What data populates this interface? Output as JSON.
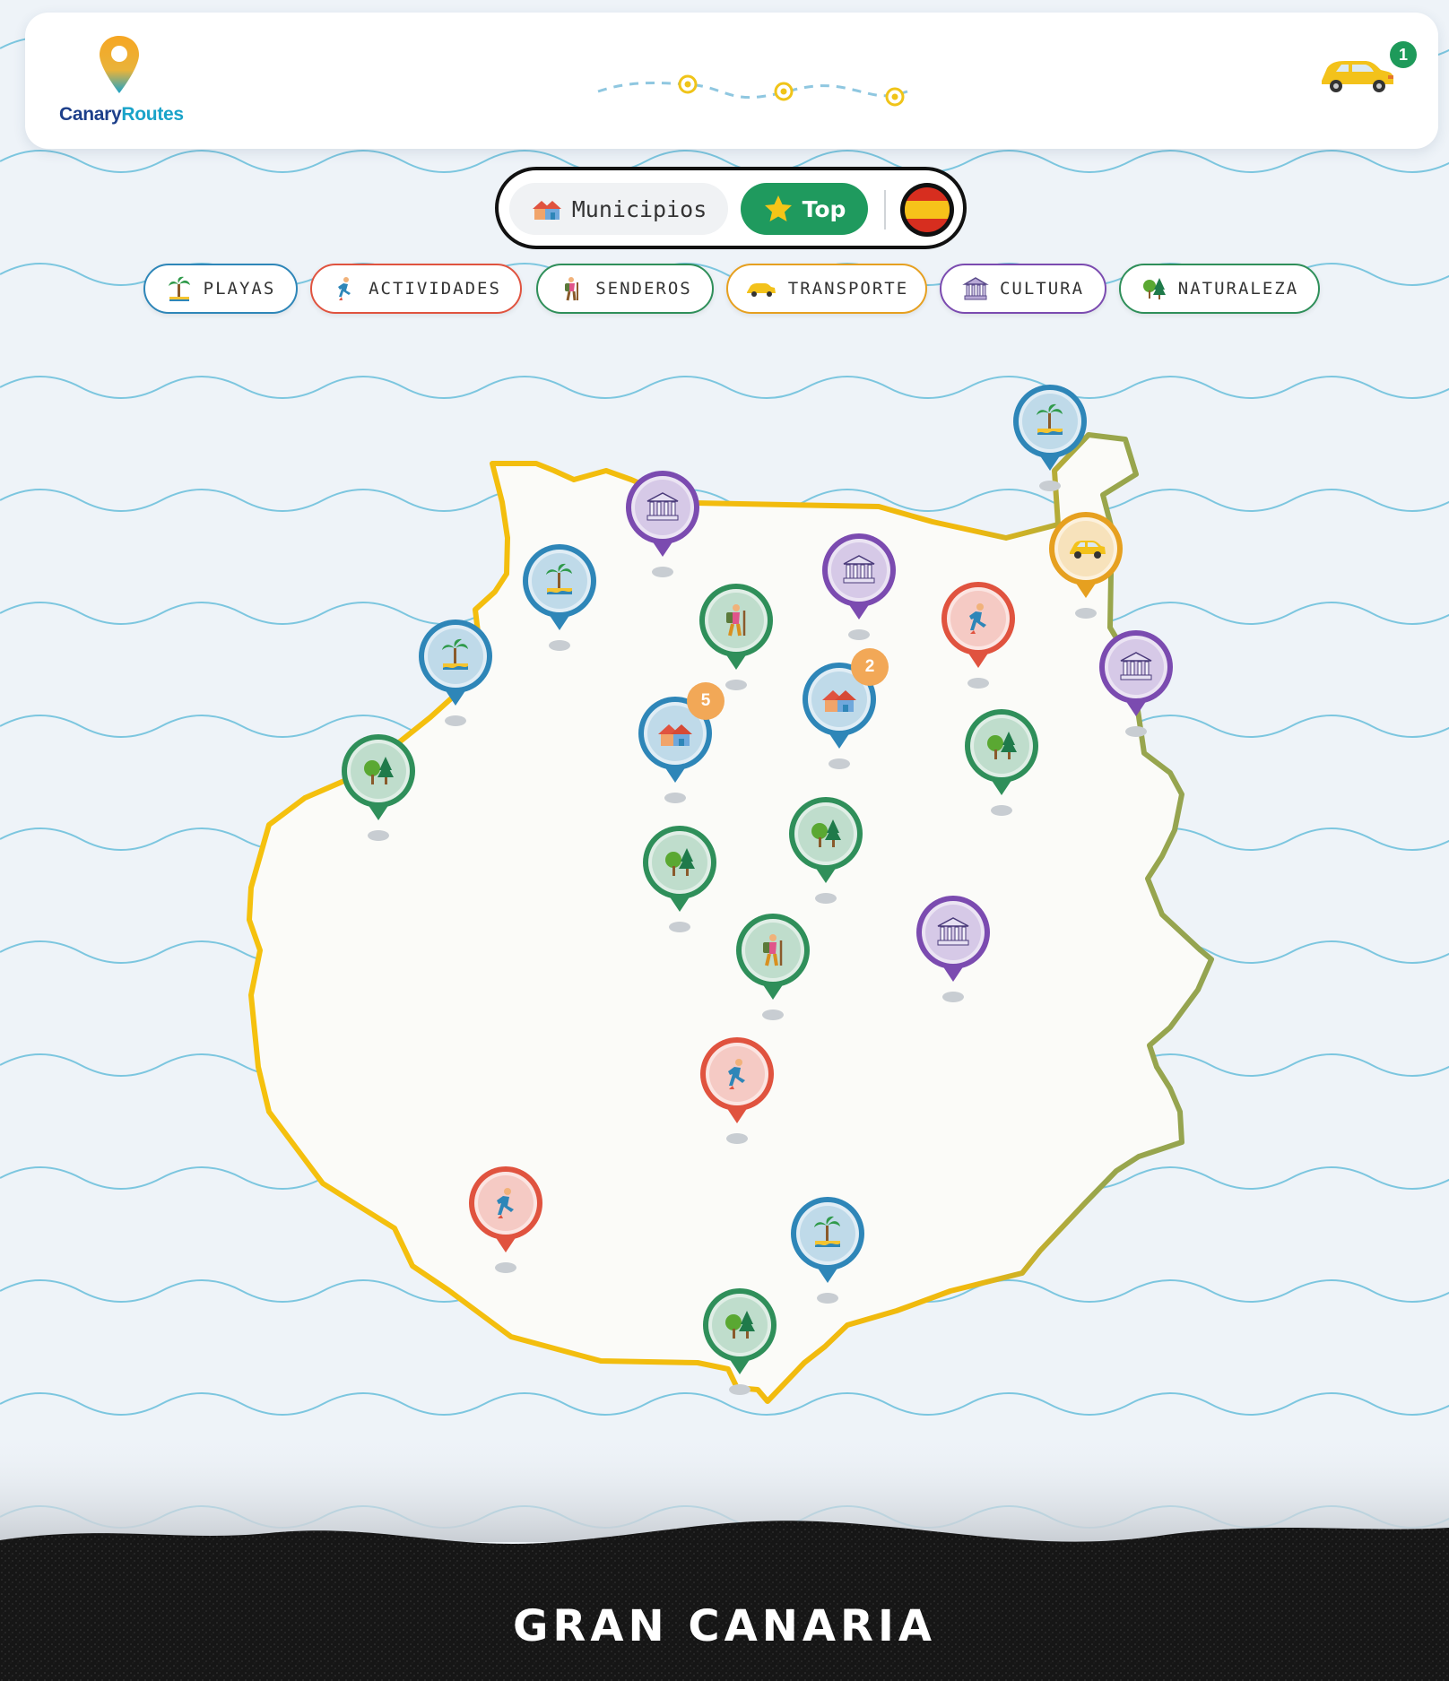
{
  "app": {
    "logo_part1": "Canary",
    "logo_part2": "Routes"
  },
  "header": {
    "cart_count": "1"
  },
  "modes": {
    "municipios_label": "Municipios",
    "municipios_icon": "houses-icon",
    "top_label": "Top",
    "top_icon": "star-icon",
    "language_icon": "spain-flag-icon"
  },
  "filters": [
    {
      "label": "PLAYAS",
      "icon": "palm-beach-icon",
      "color": "#2e86b8"
    },
    {
      "label": "ACTIVIDADES",
      "icon": "runner-icon",
      "color": "#e0533f"
    },
    {
      "label": "SENDEROS",
      "icon": "hiker-icon",
      "color": "#2f8f5a"
    },
    {
      "label": "TRANSPORTE",
      "icon": "car-icon",
      "color": "#e6a020"
    },
    {
      "label": "CULTURA",
      "icon": "museum-icon",
      "color": "#7b4bb0"
    },
    {
      "label": "NATURALEZA",
      "icon": "trees-icon",
      "color": "#2f8f5a"
    }
  ],
  "map": {
    "island_name": "GRAN CANARIA",
    "category_colors": {
      "beach": "#2e86b8",
      "activity": "#e0533f",
      "trail": "#2f8f5a",
      "transport": "#e6a020",
      "culture": "#7b4bb0",
      "nature": "#2f8f5a",
      "municipality": "#2e86b8"
    },
    "cluster_counts": [
      "5",
      "2"
    ]
  }
}
